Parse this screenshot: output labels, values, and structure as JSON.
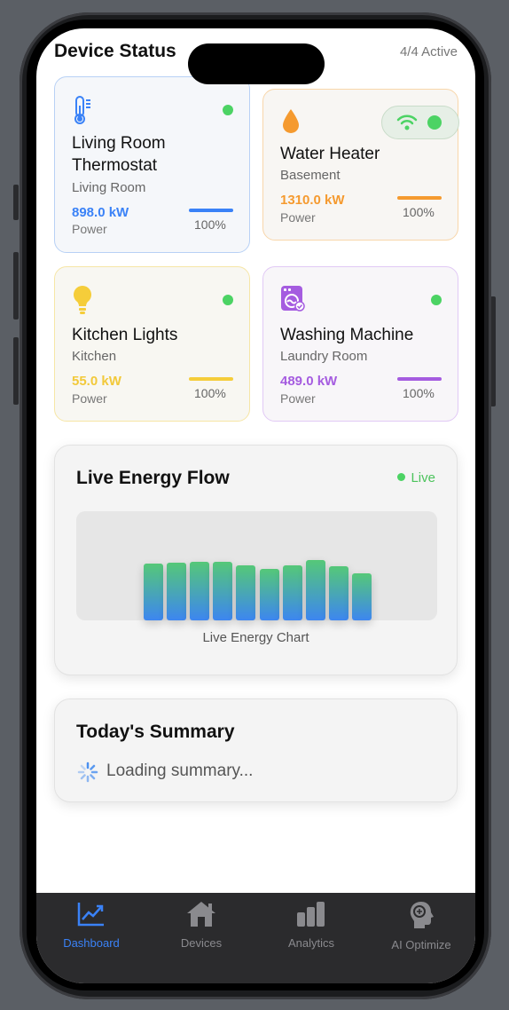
{
  "header": {
    "title": "Device Status",
    "active_count": "4/4 Active"
  },
  "devices": [
    {
      "name": "Living Room Thermostat",
      "location": "Living Room",
      "power": "898.0 kW",
      "power_label": "Power",
      "percent": "100%",
      "color": "#3a82f7",
      "icon": "thermometer-icon"
    },
    {
      "name": "Water Heater",
      "location": "Basement",
      "power": "1310.0 kW",
      "power_label": "Power",
      "percent": "100%",
      "color": "#f59a2f",
      "icon": "water-drop-icon"
    },
    {
      "name": "Kitchen Lights",
      "location": "Kitchen",
      "power": "55.0 kW",
      "power_label": "Power",
      "percent": "100%",
      "color": "#f5cd3a",
      "icon": "lightbulb-icon"
    },
    {
      "name": "Washing Machine",
      "location": "Laundry Room",
      "power": "489.0 kW",
      "power_label": "Power",
      "percent": "100%",
      "color": "#a55ce0",
      "icon": "washing-machine-icon"
    }
  ],
  "energy_flow": {
    "title": "Live Energy Flow",
    "status": "Live",
    "caption": "Live Energy Chart",
    "bar_levels": [
      0.53,
      0.54,
      0.55,
      0.55,
      0.52,
      0.48,
      0.52,
      0.57,
      0.51,
      0.44
    ]
  },
  "summary": {
    "title": "Today's Summary",
    "loading": "Loading summary..."
  },
  "tabs": [
    {
      "label": "Dashboard",
      "icon": "chart-line-icon",
      "active": true
    },
    {
      "label": "Devices",
      "icon": "house-icon",
      "active": false
    },
    {
      "label": "Analytics",
      "icon": "bar-chart-icon",
      "active": false
    },
    {
      "label": "AI Optimize",
      "icon": "brain-head-icon",
      "active": false
    }
  ],
  "colors": {
    "accent": "#3a82f7",
    "status_green": "#4cd364",
    "tabbar": "#2b2b2d"
  }
}
